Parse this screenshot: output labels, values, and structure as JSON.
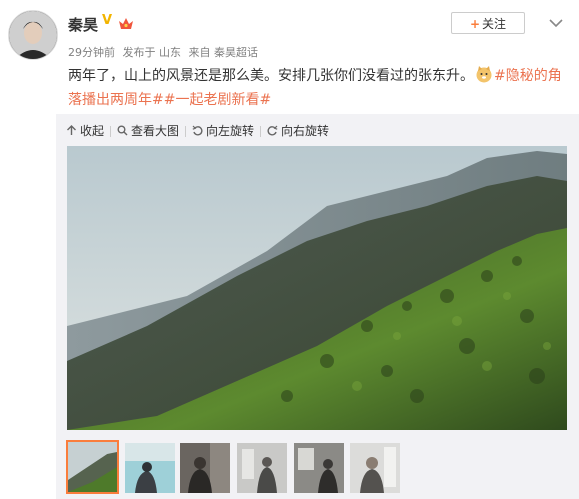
{
  "post": {
    "username": "秦昊",
    "verified_icon": "verified-v-icon",
    "vip_icon": "crown-icon",
    "meta": {
      "time": "29分钟前",
      "location": "发布于 山东",
      "source": "来自 秦昊超话"
    },
    "follow_label": "关注",
    "text_line1": "两年了，山上的风景还是那么美。安排几张你们没看过的张东升。",
    "topic_1": "#隐秘的角落播出两周年#",
    "topic_2": "#一起老剧新看#"
  },
  "toolbar": {
    "collapse": "收起",
    "view_large": "查看大图",
    "rotate_left": "向左旋转",
    "rotate_right": "向右旋转"
  },
  "colors": {
    "accent": "#fa7d3c",
    "topic": "#eb7350",
    "meta": "#808080",
    "panel_bg": "#f2f2f5"
  },
  "gallery": {
    "selected_index": 0,
    "thumbnails": [
      "mountain",
      "pool",
      "man-dark",
      "room-light",
      "room-window",
      "man-bright"
    ]
  }
}
